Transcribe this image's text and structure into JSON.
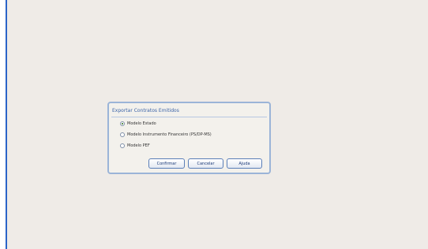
{
  "dialog": {
    "title": "Exportar Contratos Emitidos",
    "options": [
      {
        "label": "Modelo Estado",
        "selected": true
      },
      {
        "label": "Modelo Instrumento Financeiro (PS/DP-MS)",
        "selected": false
      },
      {
        "label": "Modelo PEF",
        "selected": false
      }
    ],
    "buttons": {
      "confirm": "Confirmar",
      "cancel": "Cancelar",
      "help": "Ajuda"
    }
  },
  "colors": {
    "window_background": "#efebe7",
    "window_border": "#2a64c8",
    "dialog_border": "#9bb4d8",
    "title_text": "#3b63a8"
  }
}
